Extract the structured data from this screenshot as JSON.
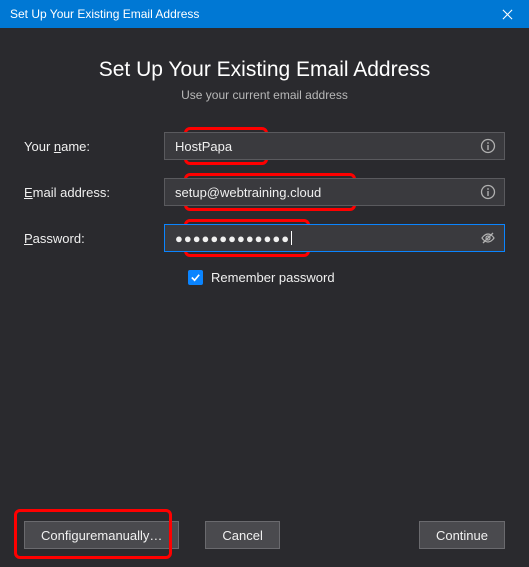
{
  "titlebar": {
    "title": "Set Up Your Existing Email Address"
  },
  "header": {
    "title": "Set Up Your Existing Email Address",
    "subtitle": "Use your current email address"
  },
  "form": {
    "name_label_pre": "Your ",
    "name_label_u": "n",
    "name_label_post": "ame:",
    "name_value": "HostPapa",
    "email_label_pre": "",
    "email_label_u": "E",
    "email_label_post": "mail address:",
    "email_value": "setup@webtraining.cloud",
    "password_label_pre": "",
    "password_label_u": "P",
    "password_label_post": "assword:",
    "password_value": "●●●●●●●●●●●●●",
    "remember_pre": "Re",
    "remember_u": "m",
    "remember_post": "ember password"
  },
  "buttons": {
    "config_pre": "Configure ",
    "config_u": "m",
    "config_post": "anually…",
    "cancel": "Cancel",
    "continue": "Continue"
  }
}
